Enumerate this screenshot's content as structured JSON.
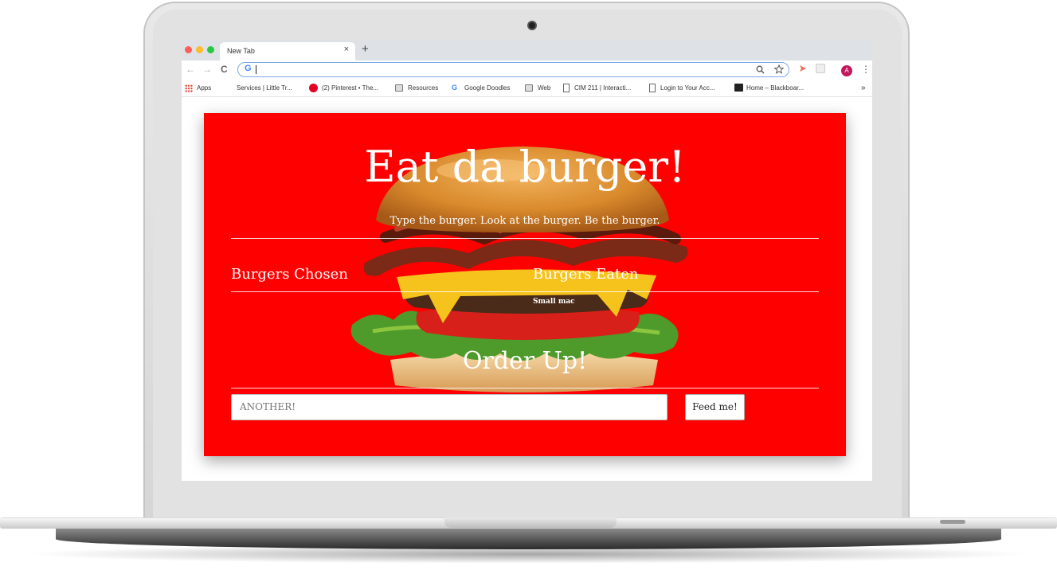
{
  "browser": {
    "tab_title": "New Tab",
    "tab_close": "×",
    "new_tab": "+",
    "back": "←",
    "forward": "→",
    "reload": "C",
    "omnibox_icon": "G",
    "avatar_letter": "A",
    "menu": "⋮",
    "bookmarks": [
      {
        "label": "Apps",
        "icon": "apps-icon"
      },
      {
        "label": "Services | Little Tr...",
        "icon": "none"
      },
      {
        "label": "(2) Pinterest • The...",
        "icon": "pinterest-icon"
      },
      {
        "label": "Resources",
        "icon": "folder-icon"
      },
      {
        "label": "Google Doodles",
        "icon": "google-icon"
      },
      {
        "label": "Web",
        "icon": "folder-icon"
      },
      {
        "label": "CIM 211 | Interacti...",
        "icon": "page-icon"
      },
      {
        "label": "Login to Your Acc...",
        "icon": "page-icon"
      },
      {
        "label": "Home – Blackboar...",
        "icon": "blackboard-icon"
      }
    ],
    "more_bookmarks": "»"
  },
  "page": {
    "title": "Eat da burger!",
    "subtitle": "Type the burger. Look at the burger. Be the burger.",
    "chosen_heading": "Burgers Chosen",
    "eaten_heading": "Burgers Eaten",
    "eaten_items": [
      "Small mac"
    ],
    "order_heading": "Order Up!",
    "input_value": "ANOTHER!",
    "submit_label": "Feed me!",
    "accent_color": "#ff0000"
  }
}
